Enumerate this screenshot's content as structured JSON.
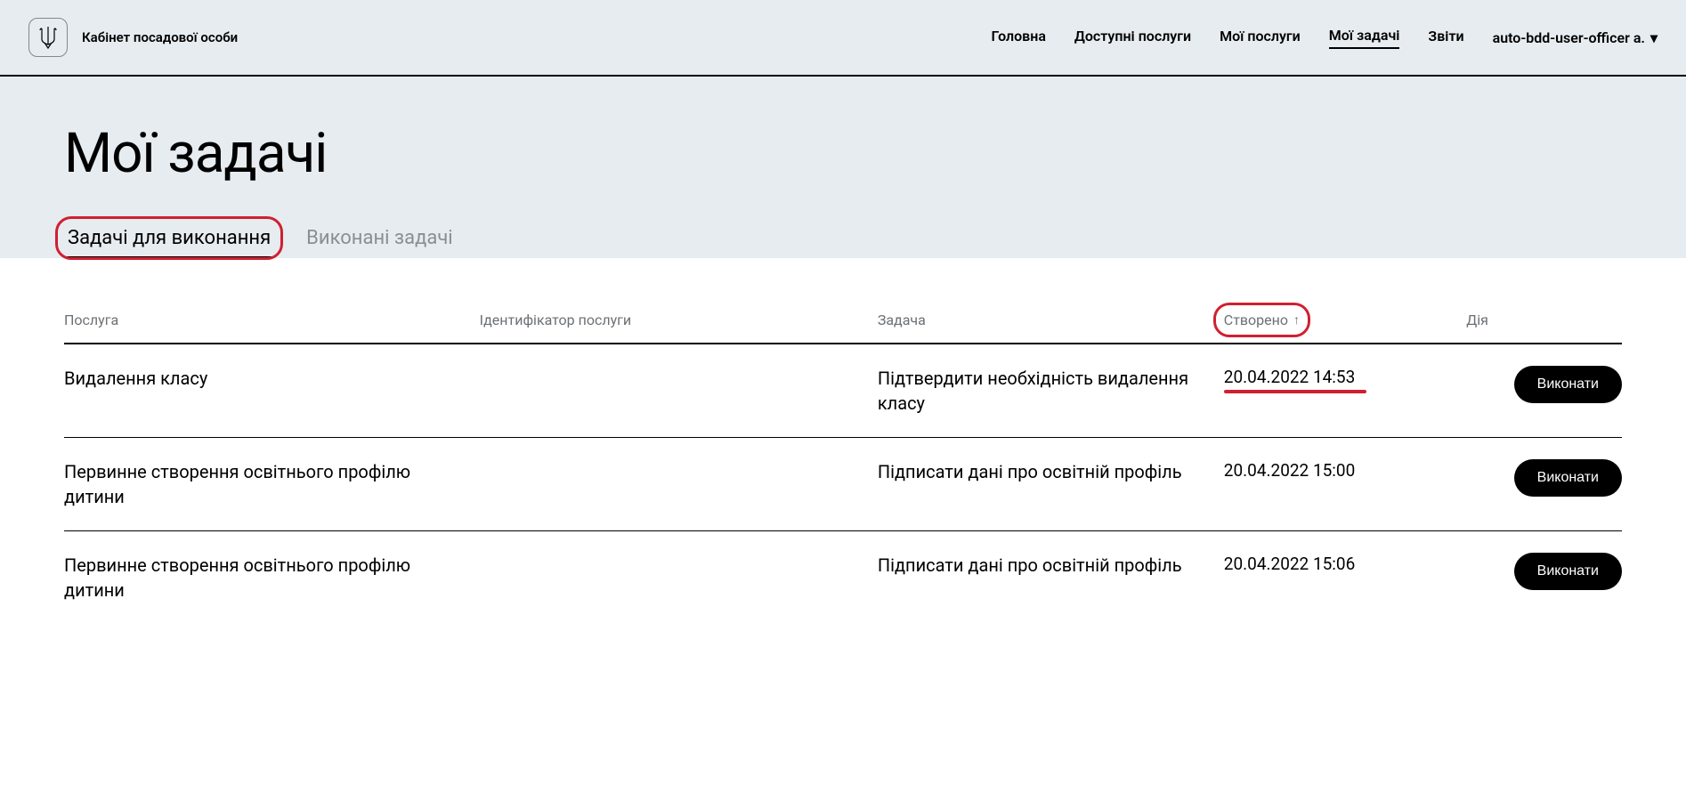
{
  "header": {
    "site_title": "Кабінет посадової особи",
    "nav": [
      {
        "label": "Головна",
        "active": false
      },
      {
        "label": "Доступні послуги",
        "active": false
      },
      {
        "label": "Мої послуги",
        "active": false
      },
      {
        "label": "Мої задачі",
        "active": true
      },
      {
        "label": "Звіти",
        "active": false
      }
    ],
    "user": "auto-bdd-user-officer a."
  },
  "page": {
    "title": "Мої задачі"
  },
  "tabs": [
    {
      "label": "Задачі для виконання",
      "active": true
    },
    {
      "label": "Виконані задачі",
      "active": false
    }
  ],
  "table": {
    "columns": {
      "service": "Послуга",
      "identifier": "Ідентифікатор послуги",
      "task": "Задача",
      "created": "Створено",
      "action": "Дія"
    },
    "sort_icon": "↑",
    "action_label": "Виконати",
    "rows": [
      {
        "service": "Видалення класу",
        "identifier": "",
        "task": "Підтвердити необхідність видалення класу",
        "created": "20.04.2022 14:53",
        "highlighted": true
      },
      {
        "service": "Первинне створення освітнього профілю дитини",
        "identifier": "",
        "task": "Підписати дані про освітній профіль",
        "created": "20.04.2022 15:00",
        "highlighted": false
      },
      {
        "service": "Первинне створення освітнього профілю дитини",
        "identifier": "",
        "task": "Підписати дані про освітній профіль",
        "created": "20.04.2022 15:06",
        "highlighted": false
      }
    ]
  }
}
